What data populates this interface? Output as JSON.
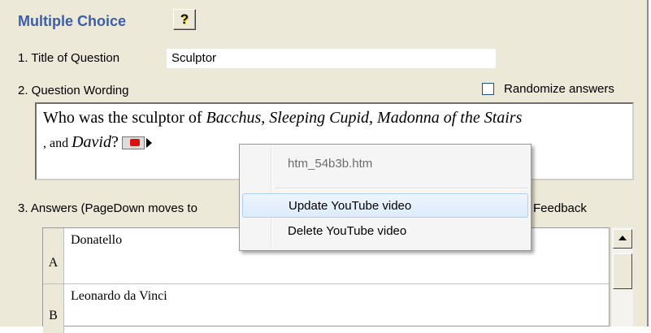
{
  "header": {
    "title": "Multiple Choice",
    "help_label": "?"
  },
  "question_title": {
    "label": "1.  Title of Question",
    "value": "Sculptor"
  },
  "question_wording": {
    "label": "2.  Question Wording",
    "randomize_label": "Randomize answers",
    "randomize_checked": false,
    "text_1": "Who was the sculptor of ",
    "work_1": "Bacchus",
    "sep_1": ", ",
    "work_2": "Sleeping Cupid",
    "sep_2": ", ",
    "work_3": "Madonna of the Stairs",
    "sep_3": ", and ",
    "work_4": "David",
    "text_end": "?"
  },
  "answers": {
    "label": "3.  Answers  (PageDown moves to",
    "feedback_label": "Feedback",
    "rows": [
      {
        "letter": "A",
        "text": "Donatello"
      },
      {
        "letter": "B",
        "text": "Leonardo da Vinci"
      }
    ]
  },
  "context_menu": {
    "filename": "htm_54b3b.htm",
    "items": [
      {
        "label": "Update YouTube video"
      },
      {
        "label": "Delete YouTube video"
      }
    ]
  },
  "icons": [
    "youtube-icon",
    "expand-arrow-icon",
    "scroll-up-arrow-icon"
  ],
  "colors": {
    "title": "#3a5ea8",
    "panel_bg": "#ece9d8",
    "menu_hover": "#dcebfc"
  }
}
